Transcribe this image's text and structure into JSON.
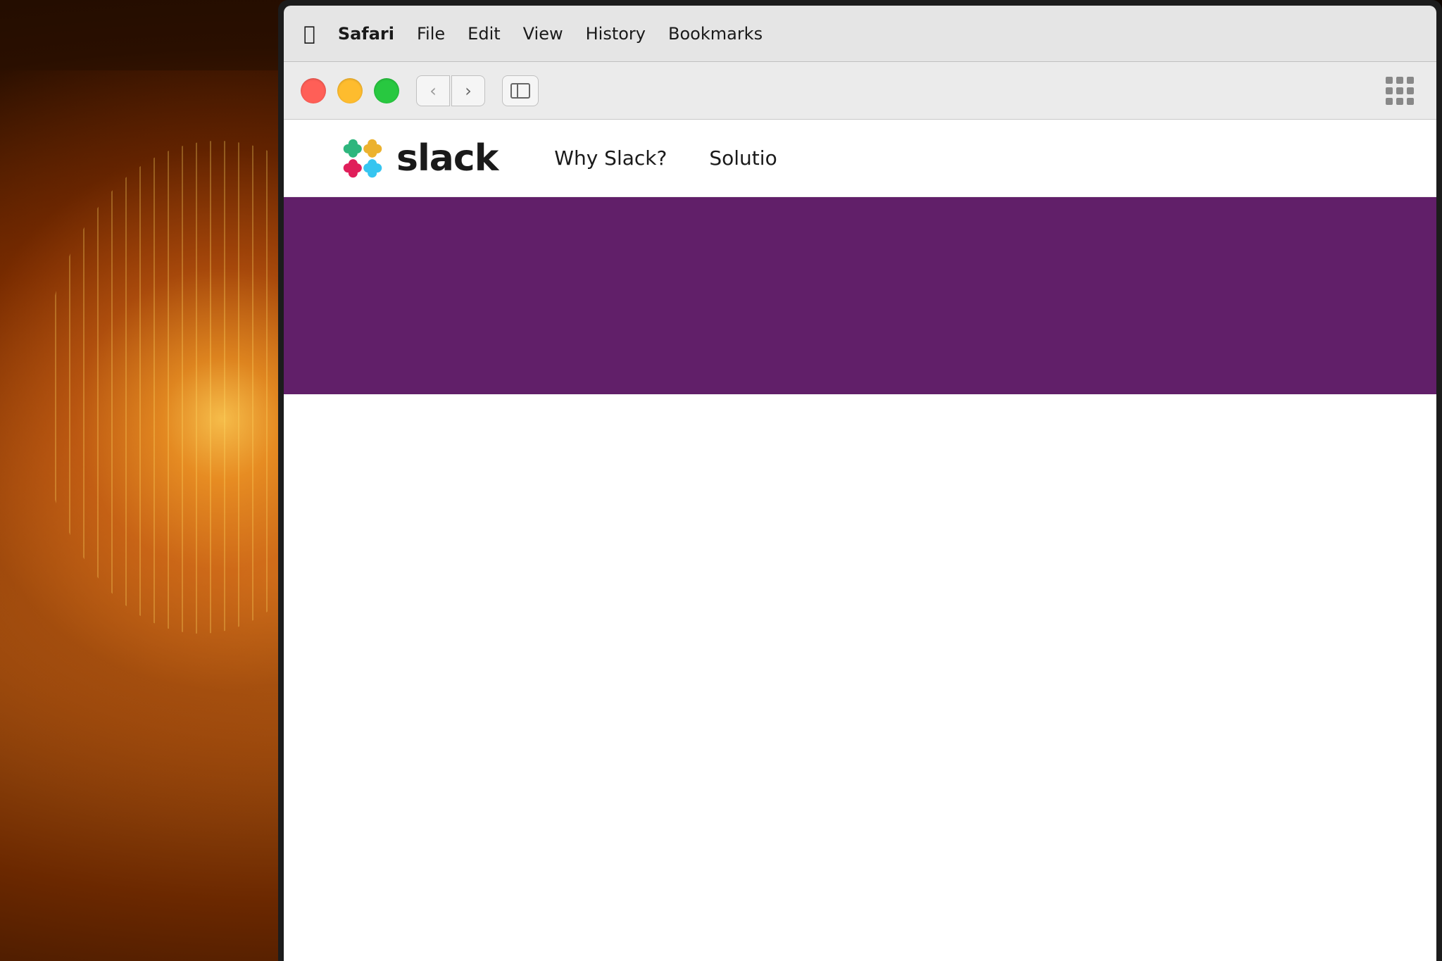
{
  "background": {
    "alt": "Warm bokeh background with lit filament bulb"
  },
  "macos": {
    "menubar": {
      "apple_icon": "🍎",
      "items": [
        {
          "id": "safari",
          "label": "Safari",
          "bold": true
        },
        {
          "id": "file",
          "label": "File",
          "bold": false
        },
        {
          "id": "edit",
          "label": "Edit",
          "bold": false
        },
        {
          "id": "view",
          "label": "View",
          "bold": false
        },
        {
          "id": "history",
          "label": "History",
          "bold": false
        },
        {
          "id": "bookmarks",
          "label": "Bookmarks",
          "bold": false
        }
      ]
    }
  },
  "safari": {
    "toolbar": {
      "back_button": "‹",
      "forward_button": "›",
      "traffic_lights": {
        "close_color": "#ff5f57",
        "minimize_color": "#febc2e",
        "maximize_color": "#28c840"
      }
    }
  },
  "slack_website": {
    "nav": {
      "brand": "slack",
      "links": [
        {
          "id": "why-slack",
          "label": "Why Slack?"
        },
        {
          "id": "solutions",
          "label": "Solutio"
        }
      ]
    },
    "hero": {
      "background_color": "#611f69"
    }
  }
}
